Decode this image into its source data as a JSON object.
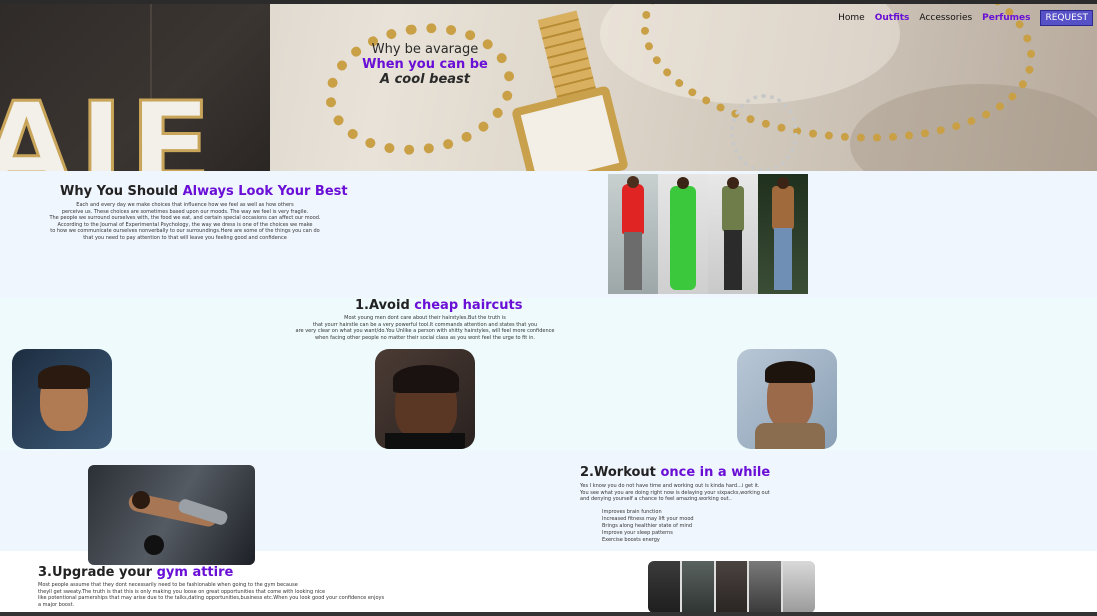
{
  "hero": {
    "line1": "Why be avarage",
    "line2": "When you can be",
    "line3": "A cool beast"
  },
  "nav": {
    "items": [
      "Home",
      "Outfits",
      "Accessories",
      "Perfumes"
    ],
    "request": "REQUEST"
  },
  "section1": {
    "title_prefix": "Why You Should ",
    "title_accent": "Always Look Your Best",
    "body": "Each and every day we make choices that influence how we feel as well as how others\nperceive us. These choices are sometimes based upon our moods. The way we feel is very fragile.\nThe people we surround ourselves with, the food we eat, and certain special occasions can affect our mood.\nAccording to the Journal of Experimental Psychology, the way we dress is one of the choices we make\nto how we communicate ourselves nonverbally to our surroundings.Here are some of the things you can do\nthat you need to pay attention to that will leave you feeling good and confidence"
  },
  "section2": {
    "title_prefix": "1.Avoid ",
    "title_accent": "cheap haircuts",
    "body": "Most young men dont care about their hairstyles.But the truth is\nthat yourr hairstle can be a very powerful tool.It commands attention and states that you\nare very clear on what you want/do.You Unlike a person with shitty hairstyles, will feel more confidence\nwhen facing other people no matter their social class as you wont feel the urge to fit in."
  },
  "section3": {
    "title_prefix": "2.Workout ",
    "title_accent": "once in a while",
    "body": "Yes I know you do not have time and working out is kinda hard...i get it.\nYou see what you are doing right now is delaying your sixpacks,working out\nand denying yourself a chance to feel amazing.working out..",
    "benefits": [
      "Improves brain function",
      "Increased fitness may lift your mood",
      "Brings along healthier state of mind",
      "Improve your sleep patterns",
      "Exercise boosts energy"
    ]
  },
  "section4": {
    "title_prefix": "3.Upgrade your ",
    "title_accent": "gym attire",
    "body": "Most people assume that they dont necessarily need to be fashionable when going to the gym because\ntheyll get sweaty.The truth is that this is only making you loose on great opportunities that come with looking nice\nlike potentional parnerships that may arise due to the talks,dating opportunities,business etc.When you look good your confidence enjoys\na major boost."
  },
  "colors": {
    "accent": "#6a0fd6",
    "request_bg": "#5751c7",
    "section_bg": "#f0f6fd"
  }
}
